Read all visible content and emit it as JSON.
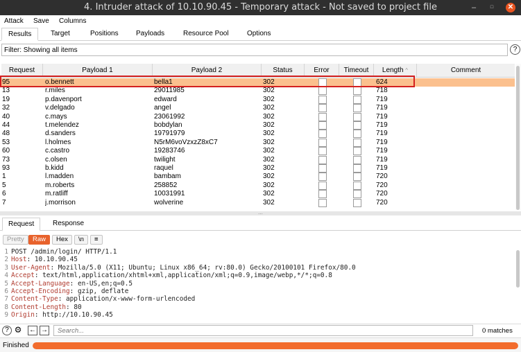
{
  "window": {
    "title": "4. Intruder attack of 10.10.90.45 - Temporary attack - Not saved to project file"
  },
  "menu": [
    "Attack",
    "Save",
    "Columns"
  ],
  "tabs": [
    "Results",
    "Target",
    "Positions",
    "Payloads",
    "Resource Pool",
    "Options"
  ],
  "filter": {
    "text": "Filter: Showing all items",
    "help_glyph": "?"
  },
  "table": {
    "columns": [
      "Request",
      "Payload 1",
      "Payload 2",
      "Status",
      "Error",
      "Timeout",
      "Length",
      "Comment"
    ],
    "sort_glyph": "^",
    "sorted_column": "Length",
    "rows": [
      {
        "request": "95",
        "payload1": "o.bennett",
        "payload2": "bella1",
        "status": "302",
        "length": "624",
        "selected": true
      },
      {
        "request": "13",
        "payload1": "r.miles",
        "payload2": "29011985",
        "status": "302",
        "length": "718",
        "selected": false
      },
      {
        "request": "19",
        "payload1": "p.davenport",
        "payload2": "edward",
        "status": "302",
        "length": "719",
        "selected": false
      },
      {
        "request": "32",
        "payload1": "v.delgado",
        "payload2": "angel",
        "status": "302",
        "length": "719",
        "selected": false
      },
      {
        "request": "40",
        "payload1": "c.mays",
        "payload2": "23061992",
        "status": "302",
        "length": "719",
        "selected": false
      },
      {
        "request": "44",
        "payload1": "t.melendez",
        "payload2": "bobdylan",
        "status": "302",
        "length": "719",
        "selected": false
      },
      {
        "request": "48",
        "payload1": "d.sanders",
        "payload2": "19791979",
        "status": "302",
        "length": "719",
        "selected": false
      },
      {
        "request": "53",
        "payload1": "l.holmes",
        "payload2": "N5rM6voVzxzZ8xC7",
        "status": "302",
        "length": "719",
        "selected": false
      },
      {
        "request": "60",
        "payload1": "c.castro",
        "payload2": "19283746",
        "status": "302",
        "length": "719",
        "selected": false
      },
      {
        "request": "73",
        "payload1": "c.olsen",
        "payload2": "twilight",
        "status": "302",
        "length": "719",
        "selected": false
      },
      {
        "request": "93",
        "payload1": "b.kidd",
        "payload2": "raquel",
        "status": "302",
        "length": "719",
        "selected": false
      },
      {
        "request": "1",
        "payload1": "l.madden",
        "payload2": "bambam",
        "status": "302",
        "length": "720",
        "selected": false
      },
      {
        "request": "5",
        "payload1": "m.roberts",
        "payload2": "258852",
        "status": "302",
        "length": "720",
        "selected": false
      },
      {
        "request": "6",
        "payload1": "m.ratliff",
        "payload2": "10031991",
        "status": "302",
        "length": "720",
        "selected": false
      },
      {
        "request": "7",
        "payload1": "j.morrison",
        "payload2": "wolverine",
        "status": "302",
        "length": "720",
        "selected": false
      }
    ]
  },
  "splitter_glyph": "...",
  "detail_tabs": [
    "Request",
    "Response"
  ],
  "view_buttons": [
    "Pretty",
    "Raw",
    "Hex",
    "\\n",
    "≡"
  ],
  "request_lines": [
    {
      "num": "1",
      "name": "",
      "value": "POST /admin/login/ HTTP/1.1"
    },
    {
      "num": "2",
      "name": "Host",
      "value": ": 10.10.90.45"
    },
    {
      "num": "3",
      "name": "User-Agent",
      "value": ": Mozilla/5.0 (X11; Ubuntu; Linux x86_64; rv:80.0) Gecko/20100101 Firefox/80.0"
    },
    {
      "num": "4",
      "name": "Accept",
      "value": ": text/html,application/xhtml+xml,application/xml;q=0.9,image/webp,*/*;q=0.8"
    },
    {
      "num": "5",
      "name": "Accept-Language",
      "value": ": en-US,en;q=0.5"
    },
    {
      "num": "6",
      "name": "Accept-Encoding",
      "value": ": gzip, deflate"
    },
    {
      "num": "7",
      "name": "Content-Type",
      "value": ": application/x-www-form-urlencoded"
    },
    {
      "num": "8",
      "name": "Content-Length",
      "value": ": 80"
    },
    {
      "num": "9",
      "name": "Origin",
      "value": ": http://10.10.90.45"
    }
  ],
  "search": {
    "placeholder": "Search...",
    "matches": "0 matches",
    "help_glyph": "?",
    "gear_glyph": "⚙",
    "prev_glyph": "←",
    "next_glyph": "→"
  },
  "status": {
    "text": "Finished",
    "progress": 1.0,
    "progress_color": "#f26b2c"
  },
  "colors": {
    "accent": "#e8622c",
    "selected_row": "#fbc08e",
    "highlight_border": "#d42020"
  },
  "icons": {
    "window_min": "–",
    "window_max": "□",
    "window_close": "✕"
  }
}
